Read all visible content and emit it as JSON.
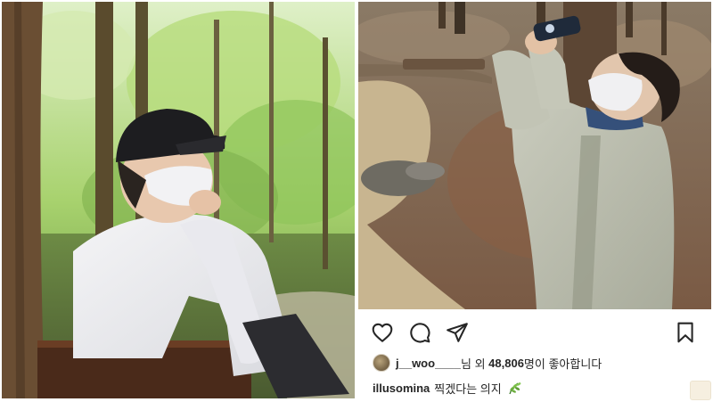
{
  "post": {
    "actions": {
      "like_icon": "heart-icon",
      "comment_icon": "comment-icon",
      "share_icon": "send-icon",
      "save_icon": "bookmark-icon"
    },
    "likes": {
      "user": "j__woo____",
      "text_middle": "님 외 ",
      "count": "48,806",
      "text_end": "명이 좋아합니다"
    },
    "caption": {
      "user": "illusomina",
      "text": "찍겠다는 의지",
      "emoji": "leaf-emoji"
    }
  },
  "colors": {
    "text": "#262626",
    "background": "#ffffff"
  }
}
